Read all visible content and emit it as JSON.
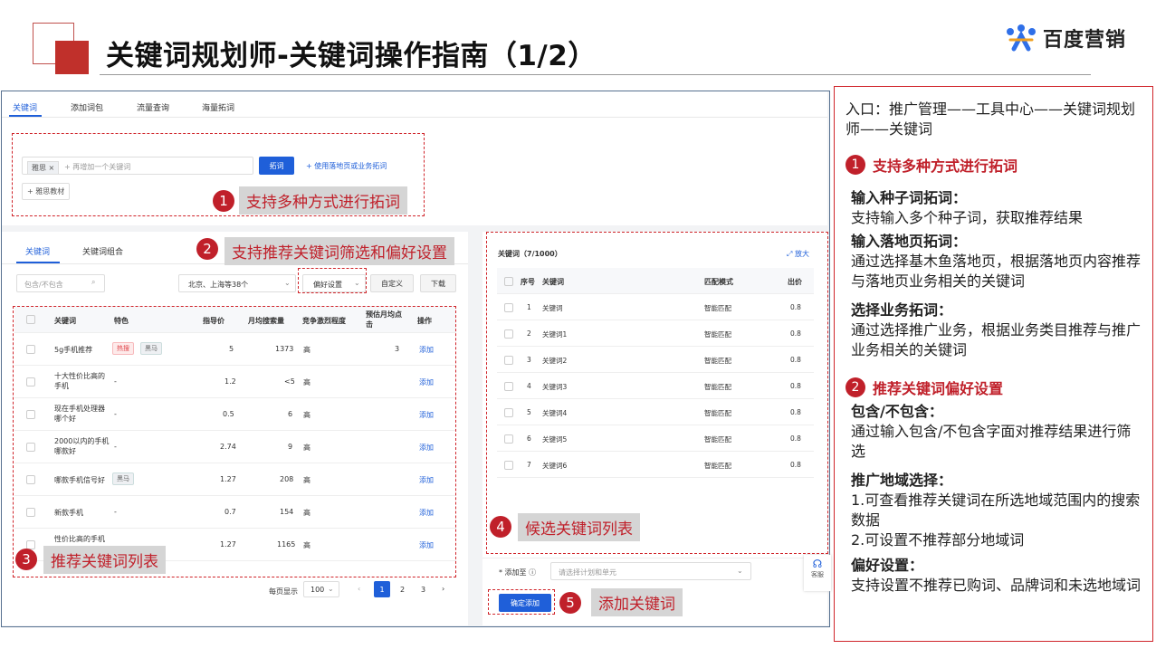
{
  "slide": {
    "title": "关键词规划师-关键词操作指南（1/2）",
    "logo_text": "百度营销"
  },
  "app": {
    "top_tabs": [
      "关键词",
      "添加词包",
      "流量查询",
      "海量拓词"
    ],
    "seed_tag": "雅思",
    "seed_placeholder": "+ 再增加一个关键词",
    "expand_button": "拓词",
    "landing_link": "+ 使用落地页或业务拓词",
    "extra_seed": "+ 雅思教材",
    "sub_tabs": [
      "关键词",
      "关键词组合"
    ],
    "include_placeholder": "包含/不包含",
    "region_select": "北京、上海等38个",
    "preference_button": "偏好设置",
    "custom_button": "自定义",
    "download_button": "下载",
    "table_headers": [
      "关键词",
      "特色",
      "指导价",
      "月均搜索量",
      "竞争激烈程度",
      "预估月均点击",
      "操作"
    ],
    "rows": [
      {
        "kw": "5g手机推荐",
        "tags": [
          "热搜",
          "黑马"
        ],
        "price": "5",
        "volume": "1373",
        "comp": "高",
        "est": "3",
        "op": "添加"
      },
      {
        "kw": "十大性价比高的手机",
        "tags": [],
        "feat": "-",
        "price": "1.2",
        "volume": "<5",
        "comp": "高",
        "op": "添加"
      },
      {
        "kw": "现在手机处理器哪个好",
        "tags": [],
        "feat": "-",
        "price": "0.5",
        "volume": "6",
        "comp": "高",
        "op": "添加"
      },
      {
        "kw": "2000以内的手机哪款好",
        "tags": [],
        "feat": "-",
        "price": "2.74",
        "volume": "9",
        "comp": "高",
        "op": "添加"
      },
      {
        "kw": "哪款手机信号好",
        "tags": [
          "黑马"
        ],
        "price": "1.27",
        "volume": "208",
        "comp": "高",
        "op": "添加"
      },
      {
        "kw": "新款手机",
        "tags": [],
        "feat": "-",
        "price": "0.7",
        "volume": "154",
        "comp": "高",
        "op": "添加"
      },
      {
        "kw": "性价比高的手机",
        "tags": [],
        "feat": "",
        "price": "1.27",
        "volume": "1165",
        "comp": "高",
        "op": "添加"
      }
    ],
    "pagination": {
      "label": "每页显示",
      "size": "100",
      "pages": [
        "1",
        "2",
        "3"
      ],
      "current": "1"
    },
    "right_panel": {
      "title": "关键词（7/1000）",
      "zoom": "放大",
      "headers": [
        "序号",
        "关键词",
        "匹配模式",
        "出价"
      ],
      "rows": [
        {
          "n": "1",
          "kw": "关键词",
          "mode": "智能匹配",
          "bid": "0.8"
        },
        {
          "n": "2",
          "kw": "关键词1",
          "mode": "智能匹配",
          "bid": "0.8"
        },
        {
          "n": "3",
          "kw": "关键词2",
          "mode": "智能匹配",
          "bid": "0.8"
        },
        {
          "n": "4",
          "kw": "关键词3",
          "mode": "智能匹配",
          "bid": "0.8"
        },
        {
          "n": "5",
          "kw": "关键词4",
          "mode": "智能匹配",
          "bid": "0.8"
        },
        {
          "n": "6",
          "kw": "关键词5",
          "mode": "智能匹配",
          "bid": "0.8"
        },
        {
          "n": "7",
          "kw": "关键词6",
          "mode": "智能匹配",
          "bid": "0.8"
        }
      ],
      "add_to_label": "* 添加至",
      "add_to_placeholder": "请选择计划和单元",
      "confirm_button": "确定添加",
      "service": "客服"
    }
  },
  "callouts": [
    {
      "n": "1",
      "text": "支持多种方式进行拓词"
    },
    {
      "n": "2",
      "text": "支持推荐关键词筛选和偏好设置"
    },
    {
      "n": "3",
      "text": "推荐关键词列表"
    },
    {
      "n": "4",
      "text": "候选关键词列表"
    },
    {
      "n": "5",
      "text": "添加关键词"
    }
  ],
  "guide": {
    "entry": "入口：推广管理——工具中心——关键词规划师——关键词",
    "sec1_title": "支持多种方式进行拓词",
    "s1a_h": "输入种子词拓词：",
    "s1a_t": "支持输入多个种子词，获取推荐结果",
    "s1b_h": "输入落地页拓词：",
    "s1b_t": "通过选择基木鱼落地页，根据落地页内容推荐与落地页业务相关的关键词",
    "s1c_h": "选择业务拓词：",
    "s1c_t": "通过选择推广业务，根据业务类目推荐与推广业务相关的关键词",
    "sec2_title": "推荐关键词偏好设置",
    "s2a_h": "包含/不包含：",
    "s2a_t": "通过输入包含/不包含字面对推荐结果进行筛选",
    "s2b_h": "推广地域选择：",
    "s2b_t1": "1.可查看推荐关键词在所选地域范围内的搜索数据",
    "s2b_t2": "2.可设置不推荐部分地域词",
    "s2c_h": "偏好设置：",
    "s2c_t": "支持设置不推荐已购词、品牌词和未选地域词"
  }
}
